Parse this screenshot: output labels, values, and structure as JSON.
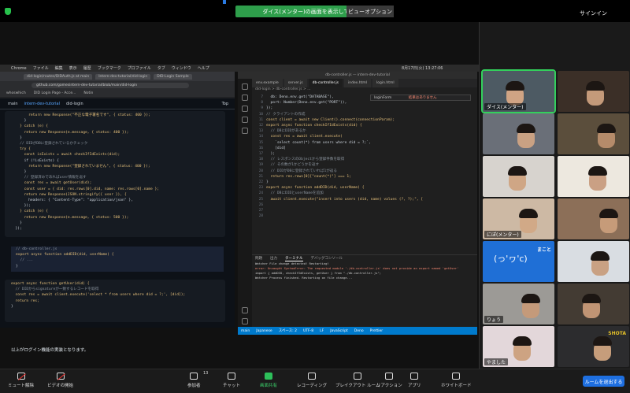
{
  "zoom": {
    "share_banner": "ダイス(メンター)の画面を表示しています",
    "view_options": "ビューオプション",
    "sign_in": "サインイン",
    "view_label": "表示"
  },
  "mac": {
    "menu": [
      "Chrome",
      "ファイル",
      "編集",
      "表示",
      "履歴",
      "ブックマーク",
      "プロファイル",
      "タブ",
      "ウィンドウ",
      "ヘルプ"
    ],
    "status": "8月17日(火) 13:27:06"
  },
  "browser": {
    "tabs": [
      "did-login/routes/DIDAuth.js at main",
      "Intern-dev-tutorial/did-login",
      "DID-Login Sample"
    ],
    "url": "github.com/gamesintern-dev-tutorial/blob/main/did-login",
    "bookmarks": [
      "whoswhich",
      "DID Login Page - Acce...",
      "Notin"
    ],
    "repo_header": {
      "branch": "main",
      "repo": "intern-dev-tutorial",
      "path": "did-login",
      "top": "Top"
    },
    "code1": [
      "        return new Response(\"不正な電子署名です\", { status: 400 });",
      "      }",
      "    } catch (e) {",
      "      return new Response(e.message, { status: 400 });",
      "    }",
      "    // DIDがDBに登録されているかチェック",
      "    try {",
      "      const isExists = await checkIfIdExists(did);",
      "      if (!isExists) {",
      "        return new Response(\"登録されていません\", { status: 400 });",
      "      }",
      "      // 登録済みであればuser情報を返す",
      "      const res = await getUser(did);",
      "      const user = { did: res.rows[0].did, name: res.rows[0].name };",
      "      return new Response(JSON.stringify({ user }), {",
      "        headers: { \"Content-Type\": \"application/json\" },",
      "      });",
      "    } catch (e) {",
      "      return new Response(e.message, { status: 500 });",
      "    }",
      "  });"
    ],
    "snippet": [
      "// db-controller.js",
      "export async function addDID(did, userName) {",
      "  // ...",
      "}"
    ],
    "code2": [
      "export async function getUser(did) {",
      "  // DIDからsignatureが一致するレコードを取得",
      "  const res = await client.execute('select * from users where did = ?;', [did]);",
      "  return res;",
      "}"
    ],
    "conclusion": "以上がログイン機能の実装となります。"
  },
  "vscode": {
    "title": "db-controller.js — intern-dev-tutorial",
    "tabs": [
      "env.example",
      "server.js",
      "db-controller.js",
      "index.html",
      "login.html"
    ],
    "active_tab": 2,
    "breadcrumb": "did-login > db-controller.js > ...",
    "find": "loginForm",
    "find_result": "結果はありません",
    "line_numbers": [
      "7",
      "8",
      "9",
      "10",
      "11",
      "12",
      "13",
      "14",
      "15",
      "16",
      "17",
      "18",
      "19",
      "20",
      "21",
      "22",
      "23",
      "24",
      "25",
      "26",
      "27",
      "28"
    ],
    "code": [
      "  db: Deno.env.get(\"DATABASE\"),",
      "  port: Number(Deno.env.get(\"PORT\")),",
      "});",
      "",
      "// クライアントの作成",
      "const client = await new Client().connect(connectionParam);",
      "",
      "export async function checkIfIdExists(did) {",
      "  // DBにDIDがあるか",
      "  const res = await client.execute(",
      "    `select count(*) from users where did = ?;`,",
      "    [did]",
      "  );",
      "  // レスポンスのObjectから登録件数を取得",
      "  // その数が1かどうかを返す",
      "  // DIDがDBに登録されていれば1が返る",
      "  return res.rows[0][\"count(*)\"] === 1;",
      "}",
      "",
      "export async function addDID(did, userName) {",
      "  // DBにDIDとuserNameを追加",
      "  await client.execute(\"insert into users (did, name) values (?, ?);\", ["
    ],
    "panel_tabs": [
      "問題",
      "出力",
      "ターミナル",
      "デバッグコンソール"
    ],
    "terminal": [
      "Watcher File change detected! Restarting!",
      "error: Uncaught SyntaxError: The requested module './db-controller.js' does not provide an export named 'getUser'",
      "import { addDID, checkIfIdExists, getUser } from \"./db-controller.js\";",
      "Watcher Process finished. Restarting on file change..."
    ],
    "status": [
      "main",
      "Japanese",
      "スペース: 2",
      "UTF-8",
      "LF",
      "JavaScript",
      "Deno",
      "Prettier"
    ]
  },
  "participants": [
    {
      "name": "ダイス(メンター)",
      "speaking": true,
      "bg": "#4d5a63",
      "skin": "#d0a484"
    },
    {
      "name": "",
      "speaking": false,
      "bg": "#3b2f27",
      "skin": "#c49a7a"
    },
    {
      "name": "",
      "speaking": false,
      "bg": "#6a6f78",
      "skin": "#c9a183"
    },
    {
      "name": "",
      "speaking": false,
      "bg": "#5b4e3c",
      "skin": "#b58b6a"
    },
    {
      "name": "",
      "speaking": false,
      "bg": "#d7d3ce",
      "skin": "#cfa685"
    },
    {
      "name": "",
      "speaking": false,
      "bg": "#ede8df",
      "skin": "#caa084"
    },
    {
      "name": "にぽ(メンター)",
      "speaking": false,
      "bg": "#cdb9a4",
      "skin": "#d1a987"
    },
    {
      "name": "",
      "speaking": false,
      "bg": "#8c6f58",
      "skin": "#c69b79"
    },
    {
      "name": "",
      "speaking": false,
      "bg": "#1f6fd6",
      "skin": "#1f6fd6",
      "avatar_text": "(っ'ヮ'c)",
      "caption": "まこと"
    },
    {
      "name": "",
      "speaking": false,
      "bg": "#d9dde2",
      "skin": "#c9a183"
    },
    {
      "name": "りょう",
      "speaking": false,
      "bg": "#9c9a96",
      "skin": "#c49a7a"
    },
    {
      "name": "",
      "speaking": false,
      "bg": "#433b33",
      "skin": "#c09474"
    },
    {
      "name": "やました",
      "speaking": false,
      "bg": "#e3d7da",
      "skin": "#cda382"
    },
    {
      "name": "",
      "speaking": false,
      "bg": "#2c2c2e",
      "skin": "#c69d7b",
      "caption": "SHOTA"
    }
  ],
  "toolbar": {
    "buttons": [
      "ミュート解除",
      "ビデオの開始",
      "参加者",
      "チャット",
      "画面共有",
      "レコーディング",
      "ブレイクアウト ルーム",
      "リアクション",
      "アプリ",
      "ホワイトボード"
    ],
    "participant_count": "13",
    "leave": "ルームを退出する"
  }
}
